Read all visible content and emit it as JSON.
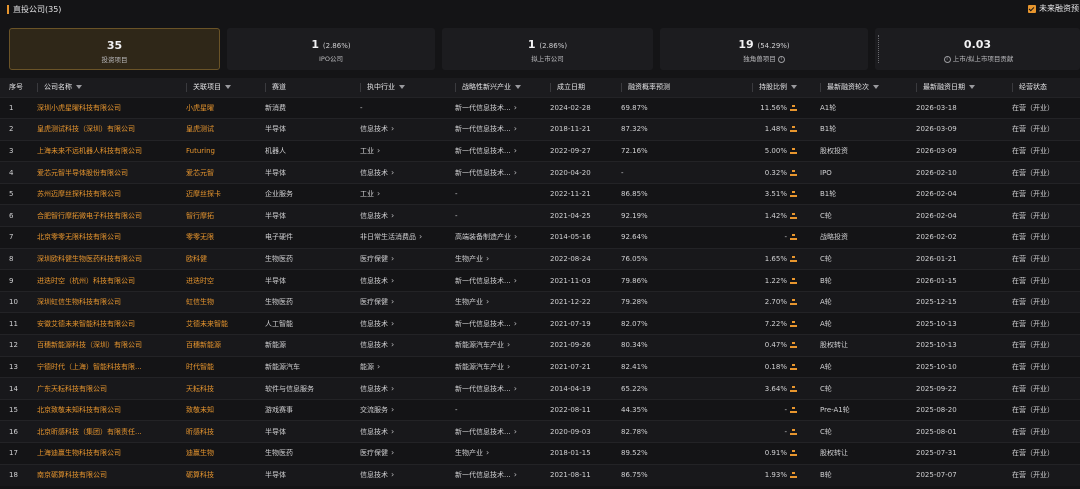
{
  "header": {
    "title": "直投公司(35)",
    "future_label": "未来融资预"
  },
  "stats": [
    {
      "num": "35",
      "pct": "",
      "label": "投资项目"
    },
    {
      "num": "1",
      "pct": "(2.86%)",
      "label": "IPO公司"
    },
    {
      "num": "1",
      "pct": "(2.86%)",
      "label": "拟上市公司"
    },
    {
      "num": "19",
      "pct": "(54.29%)",
      "label": "独角兽项目"
    },
    {
      "num": "0.03",
      "pct": "",
      "label": "上市/拟上市项目贡献"
    }
  ],
  "columns": [
    "序号",
    "公司名称",
    "关联项目",
    "赛道",
    "执中行业",
    "战略性新兴产业",
    "成立日期",
    "融资概率预测",
    "持股比例",
    "最新融资轮次",
    "最新融资日期",
    "经营状态"
  ],
  "rows": [
    {
      "no": "1",
      "company": "深圳小虎星曜科技有限公司",
      "project": "小虎星曜",
      "track": "新消费",
      "industry": "-",
      "strategic": "新一代信息技术...",
      "founded": "2024-02-28",
      "prob": "69.87%",
      "ratio": "11.56%",
      "round": "A1轮",
      "date": "2026-03-18",
      "status": "在营（开业）"
    },
    {
      "no": "2",
      "company": "皇虎测试科技（深圳）有限公司",
      "project": "皇虎测试",
      "track": "半导体",
      "industry": "信息技术",
      "strategic": "新一代信息技术...",
      "founded": "2018-11-21",
      "prob": "87.32%",
      "ratio": "1.48%",
      "round": "B1轮",
      "date": "2026-03-09",
      "status": "在营（开业）"
    },
    {
      "no": "3",
      "company": "上海未来不远机器人科技有限公司",
      "project": "Futuring",
      "track": "机器人",
      "industry": "工业",
      "strategic": "新一代信息技术...",
      "founded": "2022-09-27",
      "prob": "72.16%",
      "ratio": "5.00%",
      "round": "股权投资",
      "date": "2026-03-09",
      "status": "在营（开业）"
    },
    {
      "no": "4",
      "company": "爱芯元智半导体股份有限公司",
      "project": "爱芯元智",
      "track": "半导体",
      "industry": "信息技术",
      "strategic": "新一代信息技术...",
      "founded": "2020-04-20",
      "prob": "-",
      "ratio": "0.32%",
      "round": "IPO",
      "date": "2026-02-10",
      "status": "在营（开业）"
    },
    {
      "no": "5",
      "company": "苏州迈摩丝探科技有限公司",
      "project": "迈摩丝探卡",
      "track": "企业服务",
      "industry": "工业",
      "strategic": "-",
      "founded": "2022-11-21",
      "prob": "86.85%",
      "ratio": "3.51%",
      "round": "B1轮",
      "date": "2026-02-04",
      "status": "在营（开业）"
    },
    {
      "no": "6",
      "company": "合肥智行摩拓微电子科技有限公司",
      "project": "智行摩拓",
      "track": "半导体",
      "industry": "信息技术",
      "strategic": "-",
      "founded": "2021-04-25",
      "prob": "92.19%",
      "ratio": "1.42%",
      "round": "C轮",
      "date": "2026-02-04",
      "status": "在营（开业）"
    },
    {
      "no": "7",
      "company": "北京零零无限科技有限公司",
      "project": "零零无限",
      "track": "电子硬件",
      "industry": "非日常生活消费品",
      "strategic": "高端装备制造产业",
      "founded": "2014-05-16",
      "prob": "92.64%",
      "ratio": "-",
      "round": "战略投资",
      "date": "2026-02-02",
      "status": "在营（开业）"
    },
    {
      "no": "8",
      "company": "深圳欧科健生物医药科技有限公司",
      "project": "欧科健",
      "track": "生物医药",
      "industry": "医疗保健",
      "strategic": "生物产业",
      "founded": "2022-08-24",
      "prob": "76.05%",
      "ratio": "1.65%",
      "round": "C轮",
      "date": "2026-01-21",
      "status": "在营（开业）"
    },
    {
      "no": "9",
      "company": "进迭时空（杭州）科技有限公司",
      "project": "进迭时空",
      "track": "半导体",
      "industry": "信息技术",
      "strategic": "新一代信息技术...",
      "founded": "2021-11-03",
      "prob": "79.86%",
      "ratio": "1.22%",
      "round": "B轮",
      "date": "2026-01-15",
      "status": "在营（开业）"
    },
    {
      "no": "10",
      "company": "深圳虹信生物科技有限公司",
      "project": "虹信生物",
      "track": "生物医药",
      "industry": "医疗保健",
      "strategic": "生物产业",
      "founded": "2021-12-22",
      "prob": "79.28%",
      "ratio": "2.70%",
      "round": "A轮",
      "date": "2025-12-15",
      "status": "在营（开业）"
    },
    {
      "no": "11",
      "company": "安徽艾德未来智能科技有限公司",
      "project": "艾德未来智能",
      "track": "人工智能",
      "industry": "信息技术",
      "strategic": "新一代信息技术...",
      "founded": "2021-07-19",
      "prob": "82.07%",
      "ratio": "7.22%",
      "round": "A轮",
      "date": "2025-10-13",
      "status": "在营（开业）"
    },
    {
      "no": "12",
      "company": "百穗新能源科技（深圳）有限公司",
      "project": "百穗新能源",
      "track": "新能源",
      "industry": "信息技术",
      "strategic": "新能源汽车产业",
      "founded": "2021-09-26",
      "prob": "80.34%",
      "ratio": "0.47%",
      "round": "股权转让",
      "date": "2025-10-13",
      "status": "在营（开业）"
    },
    {
      "no": "13",
      "company": "宁德时代（上海）智能科技有限...",
      "project": "时代智能",
      "track": "新能源汽车",
      "industry": "能源",
      "strategic": "新能源汽车产业",
      "founded": "2021-07-21",
      "prob": "82.41%",
      "ratio": "0.18%",
      "round": "A轮",
      "date": "2025-10-10",
      "status": "在营（开业）"
    },
    {
      "no": "14",
      "company": "广东天耘科技有限公司",
      "project": "天耘科技",
      "track": "软件与信息服务",
      "industry": "信息技术",
      "strategic": "新一代信息技术...",
      "founded": "2014-04-19",
      "prob": "65.22%",
      "ratio": "3.64%",
      "round": "C轮",
      "date": "2025-09-22",
      "status": "在营（开业）"
    },
    {
      "no": "15",
      "company": "北京致敬未知科技有限公司",
      "project": "致敬未知",
      "track": "游戏赛事",
      "industry": "交流服务",
      "strategic": "-",
      "founded": "2022-08-11",
      "prob": "44.35%",
      "ratio": "-",
      "round": "Pre-A1轮",
      "date": "2025-08-20",
      "status": "在营（开业）"
    },
    {
      "no": "16",
      "company": "北京昕感科技（集团）有限责任...",
      "project": "昕感科技",
      "track": "半导体",
      "industry": "信息技术",
      "strategic": "新一代信息技术...",
      "founded": "2020-09-03",
      "prob": "82.78%",
      "ratio": "-",
      "round": "C轮",
      "date": "2025-08-01",
      "status": "在营（开业）"
    },
    {
      "no": "17",
      "company": "上海迪赢生物科技有限公司",
      "project": "迪赢生物",
      "track": "生物医药",
      "industry": "医疗保健",
      "strategic": "生物产业",
      "founded": "2018-01-15",
      "prob": "89.52%",
      "ratio": "0.91%",
      "round": "股权转让",
      "date": "2025-07-31",
      "status": "在营（开业）"
    },
    {
      "no": "18",
      "company": "南京砺算科技有限公司",
      "project": "砺算科技",
      "track": "半导体",
      "industry": "信息技术",
      "strategic": "新一代信息技术...",
      "founded": "2021-08-11",
      "prob": "86.75%",
      "ratio": "1.93%",
      "round": "B轮",
      "date": "2025-07-07",
      "status": "在营（开业）"
    }
  ]
}
